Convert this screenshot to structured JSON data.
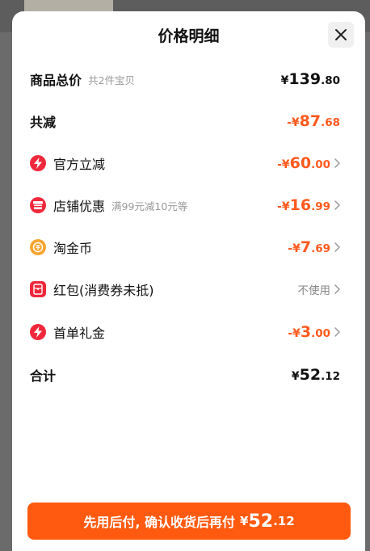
{
  "title": "价格明细",
  "total_goods": {
    "label": "商品总价",
    "sub": "共2件宝贝",
    "currency": "¥",
    "int": "139",
    "dec": ".80"
  },
  "total_discount": {
    "label": "共减",
    "prefix": "-¥",
    "int": "87",
    "dec": ".68"
  },
  "items": [
    {
      "label": "官方立减",
      "sub": "",
      "prefix": "-¥",
      "int": "60",
      "dec": ".00"
    },
    {
      "label": "店铺优惠",
      "sub": "满99元减10元等",
      "prefix": "-¥",
      "int": "16",
      "dec": ".99"
    },
    {
      "label": "淘金币",
      "sub": "",
      "prefix": "-¥",
      "int": "7",
      "dec": ".69"
    },
    {
      "label": "红包(消费券未抵)",
      "sub": "",
      "status": "不使用"
    },
    {
      "label": "首单礼金",
      "sub": "",
      "prefix": "-¥",
      "int": "3",
      "dec": ".00"
    }
  ],
  "sum": {
    "label": "合计",
    "currency": "¥",
    "int": "52",
    "dec": ".12"
  },
  "cta": {
    "text": "先用后付, 确认收货后再付",
    "currency": "¥",
    "int": "52",
    "dec": ".12"
  },
  "colors": {
    "accent": "#ff5a1f",
    "cta_bg": "#ff5a10",
    "bolt_red": "#f0283c",
    "coin_orange": "#f8a531"
  },
  "icons": {
    "official": "bolt-icon",
    "store": "store-coupon-icon",
    "coin": "taojinbi-coin-icon",
    "redpacket": "red-packet-icon",
    "first": "bolt-icon",
    "close": "close-icon",
    "chevron": "chevron-right-icon"
  }
}
